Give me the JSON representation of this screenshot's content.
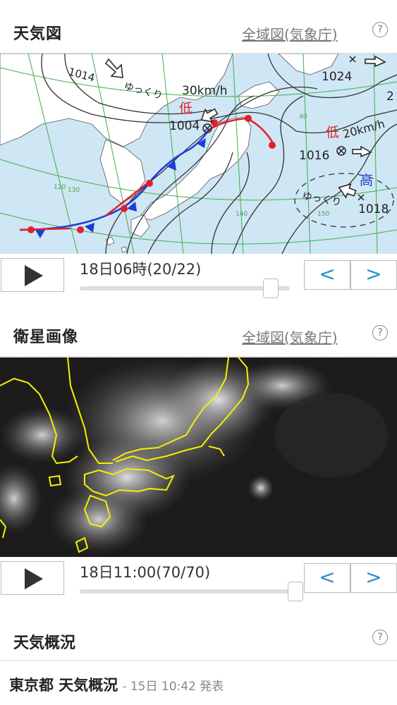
{
  "weather_chart": {
    "title": "天気図",
    "link": "全域図(気象庁)",
    "help": "?",
    "time_label": "18日06時(20/22)",
    "progress": 0.91,
    "prev": "<",
    "next": ">",
    "map_labels": {
      "p1014": "1014",
      "yukkuri1": "ゆっくり",
      "speed1": "30km/h",
      "low1": "低",
      "p1004": "1004",
      "p1024": "1024",
      "num2": "2",
      "low2": "低",
      "speed2": "20km/h",
      "p1016": "1016",
      "high": "高",
      "yukkuri2": "ゆっくり",
      "p1018": "1018",
      "grid40": "40",
      "grid130": "130",
      "grid140": "140",
      "grid150": "150",
      "grid120": "120"
    }
  },
  "satellite": {
    "title": "衛星画像",
    "link": "全域図(気象庁)",
    "help": "?",
    "time_label": "18日11:00(70/70)",
    "progress": 1.0,
    "prev": "<",
    "next": ">"
  },
  "overview": {
    "title": "天気概況",
    "help": "?",
    "region_title": "東京都 天気概況",
    "issued": "- 15日 10:42 発表"
  },
  "colors": {
    "sea": "#cfe6f5",
    "land": "#ffffff",
    "grid": "#3fae49",
    "cold_front": "#1e3cd6",
    "warm_front": "#e0202a",
    "accent": "#2a8fc9",
    "coastline_sat": "#f5f000"
  }
}
